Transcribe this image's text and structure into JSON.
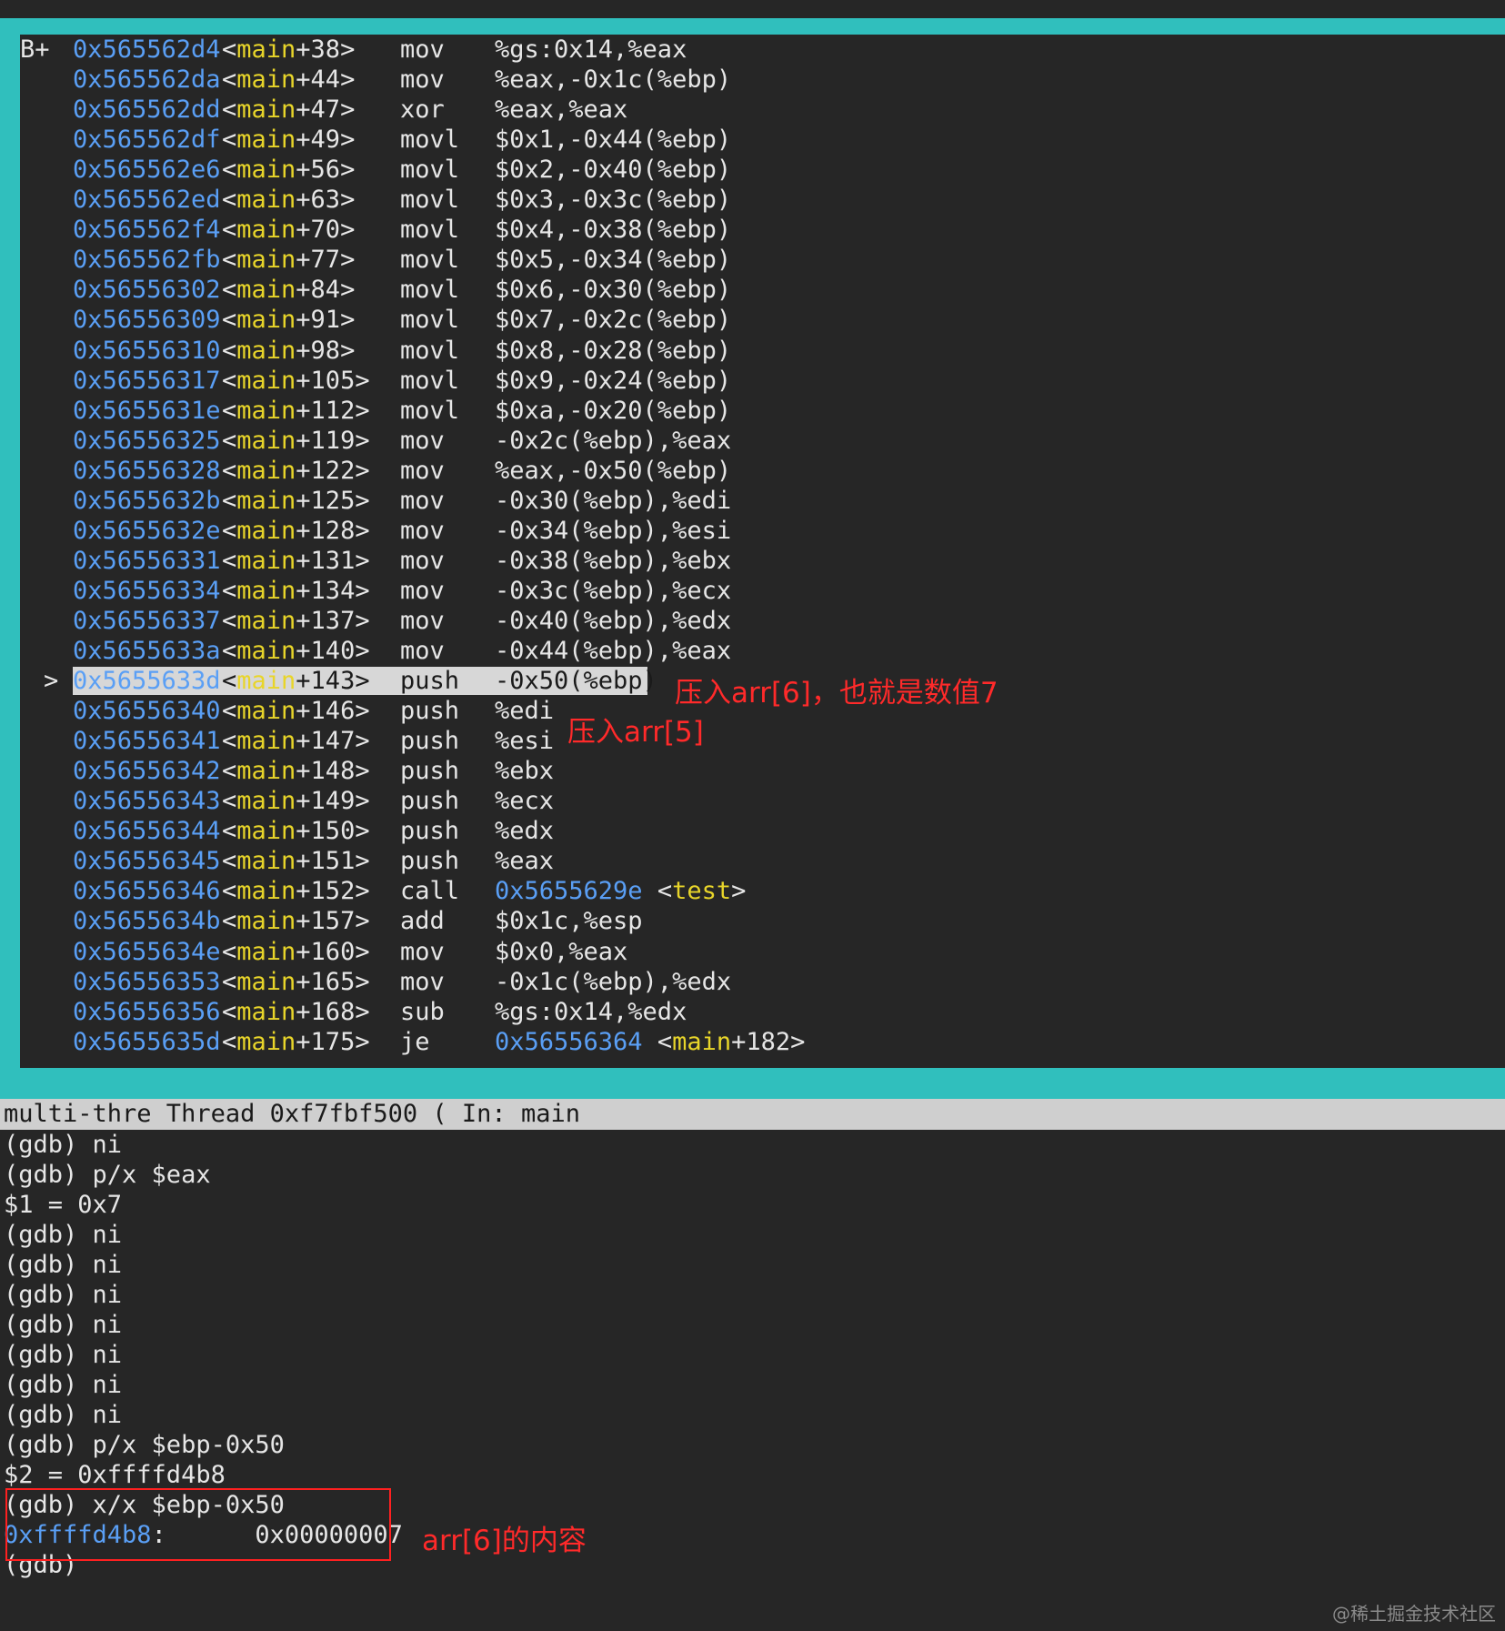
{
  "disassembly": {
    "lines": [
      {
        "marker": "B+",
        "addr": "0x565562d4",
        "fn": "main",
        "off": "+38>",
        "op": "mov",
        "args": "%gs:0x14,%eax"
      },
      {
        "marker": "",
        "addr": "0x565562da",
        "fn": "main",
        "off": "+44>",
        "op": "mov",
        "args": "%eax,-0x1c(%ebp)"
      },
      {
        "marker": "",
        "addr": "0x565562dd",
        "fn": "main",
        "off": "+47>",
        "op": "xor",
        "args": "%eax,%eax"
      },
      {
        "marker": "",
        "addr": "0x565562df",
        "fn": "main",
        "off": "+49>",
        "op": "movl",
        "args": "$0x1,-0x44(%ebp)"
      },
      {
        "marker": "",
        "addr": "0x565562e6",
        "fn": "main",
        "off": "+56>",
        "op": "movl",
        "args": "$0x2,-0x40(%ebp)"
      },
      {
        "marker": "",
        "addr": "0x565562ed",
        "fn": "main",
        "off": "+63>",
        "op": "movl",
        "args": "$0x3,-0x3c(%ebp)"
      },
      {
        "marker": "",
        "addr": "0x565562f4",
        "fn": "main",
        "off": "+70>",
        "op": "movl",
        "args": "$0x4,-0x38(%ebp)"
      },
      {
        "marker": "",
        "addr": "0x565562fb",
        "fn": "main",
        "off": "+77>",
        "op": "movl",
        "args": "$0x5,-0x34(%ebp)"
      },
      {
        "marker": "",
        "addr": "0x56556302",
        "fn": "main",
        "off": "+84>",
        "op": "movl",
        "args": "$0x6,-0x30(%ebp)"
      },
      {
        "marker": "",
        "addr": "0x56556309",
        "fn": "main",
        "off": "+91>",
        "op": "movl",
        "args": "$0x7,-0x2c(%ebp)"
      },
      {
        "marker": "",
        "addr": "0x56556310",
        "fn": "main",
        "off": "+98>",
        "op": "movl",
        "args": "$0x8,-0x28(%ebp)"
      },
      {
        "marker": "",
        "addr": "0x56556317",
        "fn": "main",
        "off": "+105>",
        "op": "movl",
        "args": "$0x9,-0x24(%ebp)"
      },
      {
        "marker": "",
        "addr": "0x5655631e",
        "fn": "main",
        "off": "+112>",
        "op": "movl",
        "args": "$0xa,-0x20(%ebp)"
      },
      {
        "marker": "",
        "addr": "0x56556325",
        "fn": "main",
        "off": "+119>",
        "op": "mov",
        "args": "-0x2c(%ebp),%eax"
      },
      {
        "marker": "",
        "addr": "0x56556328",
        "fn": "main",
        "off": "+122>",
        "op": "mov",
        "args": "%eax,-0x50(%ebp)"
      },
      {
        "marker": "",
        "addr": "0x5655632b",
        "fn": "main",
        "off": "+125>",
        "op": "mov",
        "args": "-0x30(%ebp),%edi"
      },
      {
        "marker": "",
        "addr": "0x5655632e",
        "fn": "main",
        "off": "+128>",
        "op": "mov",
        "args": "-0x34(%ebp),%esi"
      },
      {
        "marker": "",
        "addr": "0x56556331",
        "fn": "main",
        "off": "+131>",
        "op": "mov",
        "args": "-0x38(%ebp),%ebx"
      },
      {
        "marker": "",
        "addr": "0x56556334",
        "fn": "main",
        "off": "+134>",
        "op": "mov",
        "args": "-0x3c(%ebp),%ecx"
      },
      {
        "marker": "",
        "addr": "0x56556337",
        "fn": "main",
        "off": "+137>",
        "op": "mov",
        "args": "-0x40(%ebp),%edx"
      },
      {
        "marker": "",
        "addr": "0x5655633a",
        "fn": "main",
        "off": "+140>",
        "op": "mov",
        "args": "-0x44(%ebp),%eax"
      },
      {
        "marker": ">",
        "addr": "0x5655633d",
        "fn": "main",
        "off": "+143>",
        "op": "push",
        "args": "-0x50(%ebp)",
        "current": true
      },
      {
        "marker": "",
        "addr": "0x56556340",
        "fn": "main",
        "off": "+146>",
        "op": "push",
        "args": "%edi"
      },
      {
        "marker": "",
        "addr": "0x56556341",
        "fn": "main",
        "off": "+147>",
        "op": "push",
        "args": "%esi"
      },
      {
        "marker": "",
        "addr": "0x56556342",
        "fn": "main",
        "off": "+148>",
        "op": "push",
        "args": "%ebx"
      },
      {
        "marker": "",
        "addr": "0x56556343",
        "fn": "main",
        "off": "+149>",
        "op": "push",
        "args": "%ecx"
      },
      {
        "marker": "",
        "addr": "0x56556344",
        "fn": "main",
        "off": "+150>",
        "op": "push",
        "args": "%edx"
      },
      {
        "marker": "",
        "addr": "0x56556345",
        "fn": "main",
        "off": "+151>",
        "op": "push",
        "args": "%eax"
      },
      {
        "marker": "",
        "addr": "0x56556346",
        "fn": "main",
        "off": "+152>",
        "op": "call",
        "args": "",
        "target_addr": "0x5655629e",
        "target_fn": "test",
        "target_off": ">"
      },
      {
        "marker": "",
        "addr": "0x5655634b",
        "fn": "main",
        "off": "+157>",
        "op": "add",
        "args": "$0x1c,%esp"
      },
      {
        "marker": "",
        "addr": "0x5655634e",
        "fn": "main",
        "off": "+160>",
        "op": "mov",
        "args": "$0x0,%eax"
      },
      {
        "marker": "",
        "addr": "0x56556353",
        "fn": "main",
        "off": "+165>",
        "op": "mov",
        "args": "-0x1c(%ebp),%edx"
      },
      {
        "marker": "",
        "addr": "0x56556356",
        "fn": "main",
        "off": "+168>",
        "op": "sub",
        "args": "%gs:0x14,%edx"
      },
      {
        "marker": "",
        "addr": "0x5655635d",
        "fn": "main",
        "off": "+175>",
        "op": "je",
        "args": "",
        "target_addr": "0x56556364",
        "target_fn": "main",
        "target_off": "+182>"
      }
    ]
  },
  "annotations": {
    "push_arr6": "压入arr[6]，也就是数值7",
    "push_arr5": "压入arr[5]",
    "arr6_content": "arr[6]的内容"
  },
  "status_bar": "multi-thre Thread 0xf7fbf500 ( In: main",
  "console": {
    "lines": [
      {
        "text": "(gdb) ni"
      },
      {
        "text": "(gdb) p/x $eax"
      },
      {
        "text": "$1 = 0x7"
      },
      {
        "text": "(gdb) ni"
      },
      {
        "text": "(gdb) ni"
      },
      {
        "text": "(gdb) ni"
      },
      {
        "text": "(gdb) ni"
      },
      {
        "text": "(gdb) ni"
      },
      {
        "text": "(gdb) ni"
      },
      {
        "text": "(gdb) ni"
      },
      {
        "text": "(gdb) p/x $ebp-0x50"
      },
      {
        "text": "$2 = 0xffffd4b8"
      },
      {
        "text": "(gdb) x/x $ebp-0x50"
      },
      {
        "addr": "0xffffd4b8",
        "text": ":      0x00000007"
      },
      {
        "text": "(gdb)"
      }
    ]
  },
  "watermark": "@稀土掘金技术社区",
  "colors": {
    "frame": "#30bfbd",
    "address": "#5a9ff5",
    "symbol": "#e8d52a",
    "annotation": "#ff2a2a",
    "highlight": "#d7d7d7"
  }
}
